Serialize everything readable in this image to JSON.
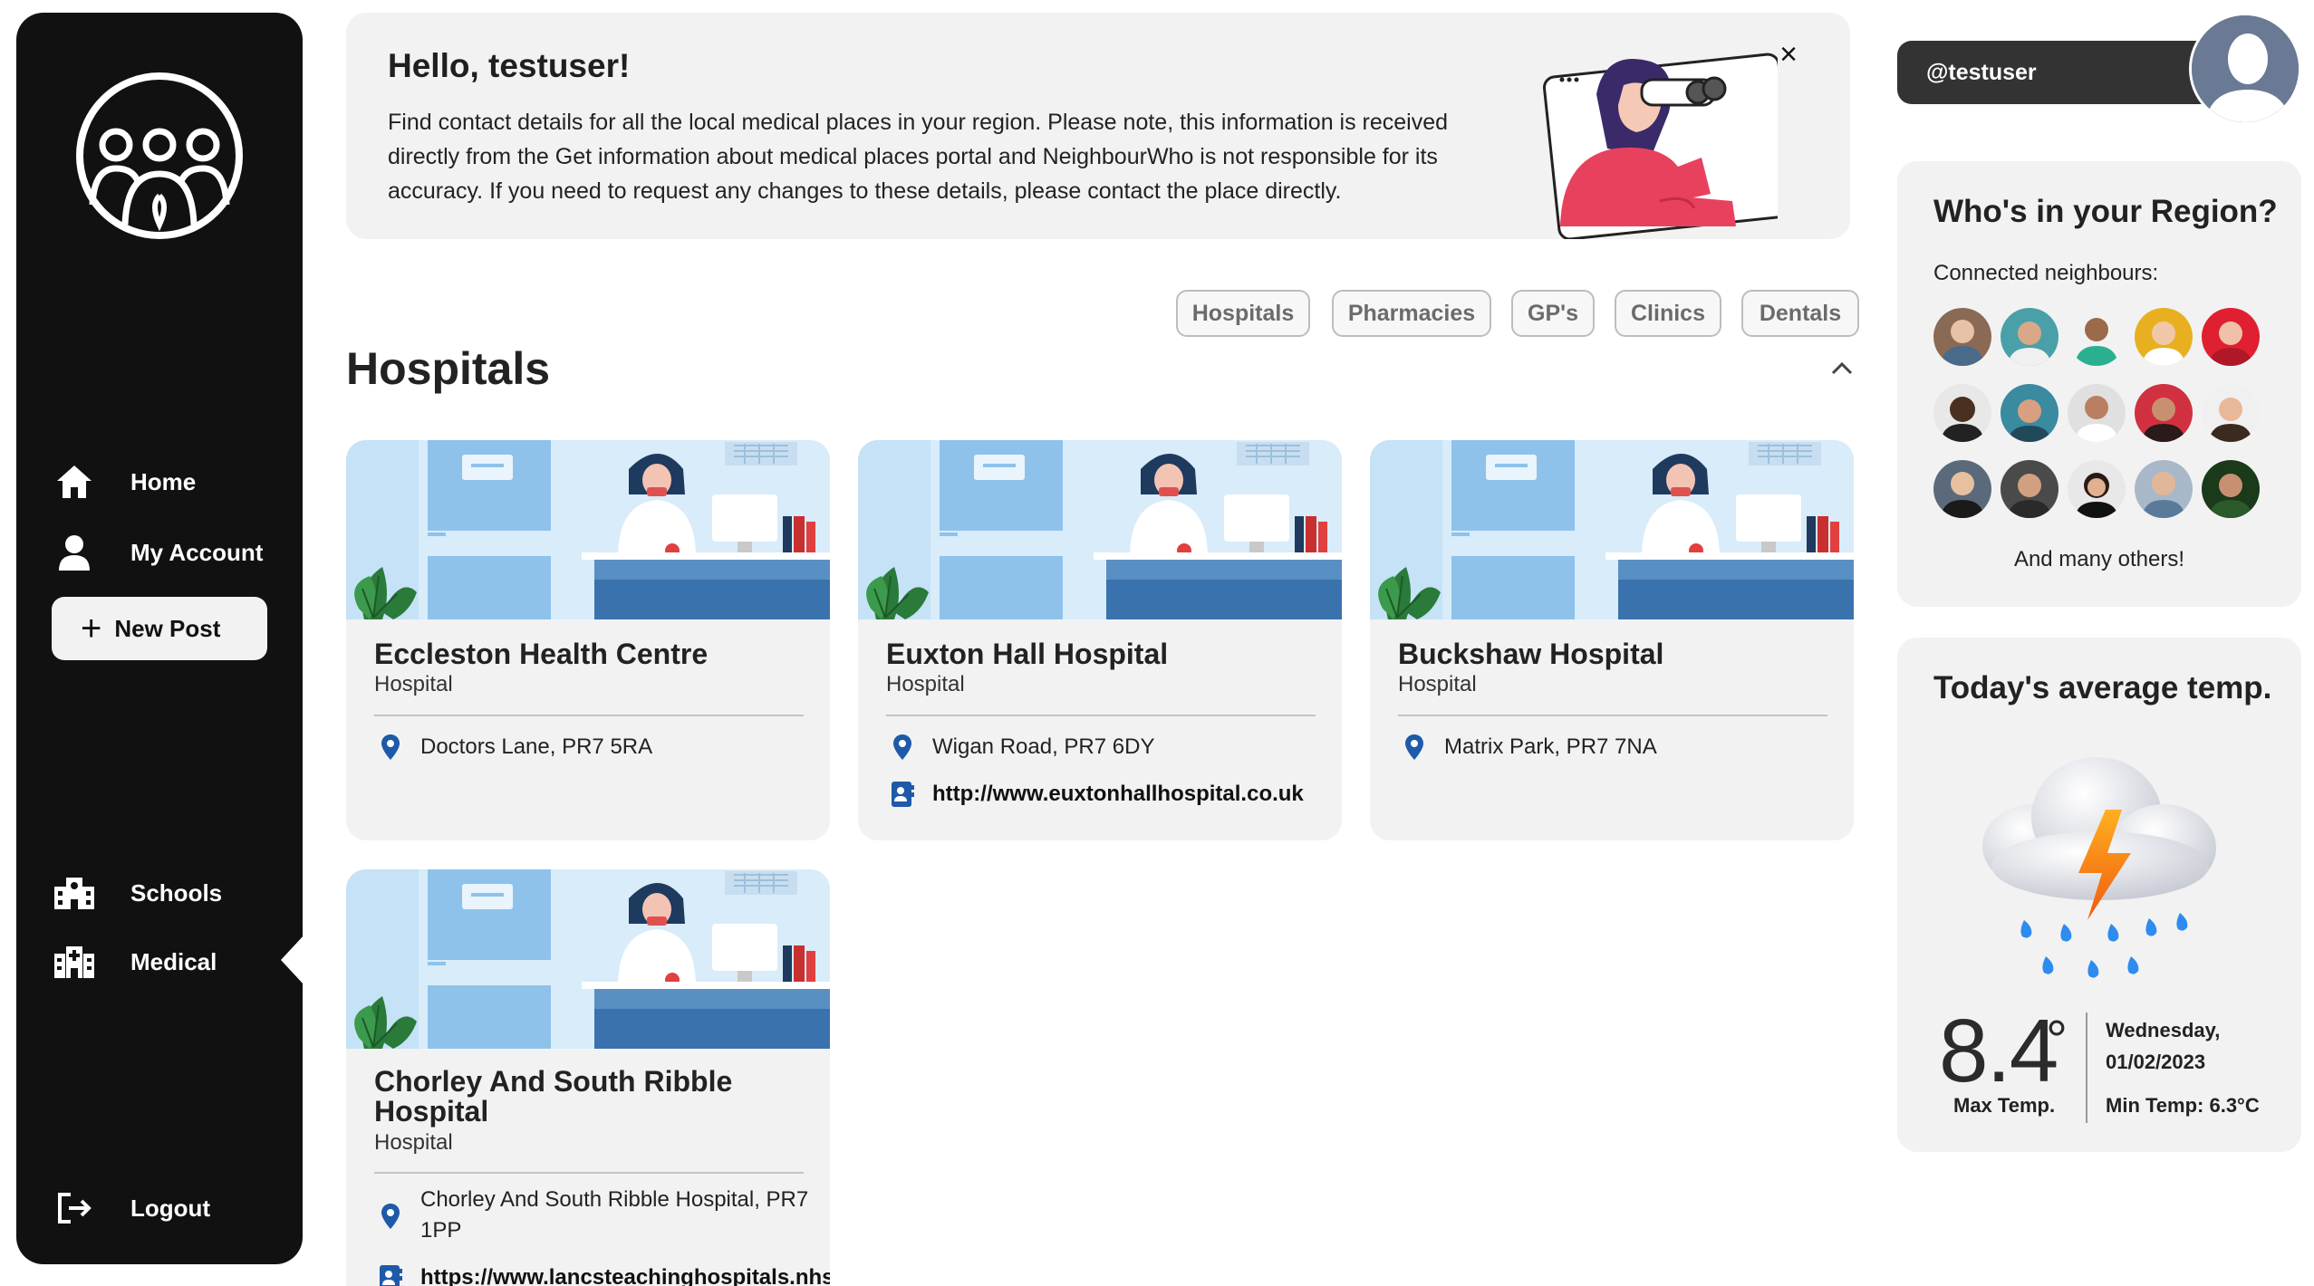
{
  "sidebar": {
    "nav": [
      {
        "label": "Home",
        "icon": "home-icon"
      },
      {
        "label": "My Account",
        "icon": "user-icon"
      },
      {
        "label": "Schools",
        "icon": "school-icon"
      },
      {
        "label": "Medical",
        "icon": "hospital-icon"
      },
      {
        "label": "Logout",
        "icon": "logout-icon"
      }
    ],
    "new_post_label": "New Post",
    "active_item": "Medical"
  },
  "banner": {
    "title": "Hello, testuser!",
    "text": "Find contact details for all the local medical places in your region. Please note, this information is received directly from the Get information about medical places portal and NeighbourWho is not responsible for its accuracy. If you need to request any changes to these details, please contact the place directly.",
    "close_label": "×"
  },
  "filters": [
    "Hospitals",
    "Pharmacies",
    "GP's",
    "Clinics",
    "Dentals"
  ],
  "section": {
    "title": "Hospitals"
  },
  "cards": [
    {
      "name": "Eccleston Health Centre",
      "type": "Hospital",
      "address": "Doctors Lane, PR7 5RA",
      "website": ""
    },
    {
      "name": "Euxton Hall Hospital",
      "type": "Hospital",
      "address": "Wigan Road, PR7 6DY",
      "website": "http://www.euxtonhallhospital.co.uk"
    },
    {
      "name": "Buckshaw Hospital",
      "type": "Hospital",
      "address": "Matrix Park, PR7 7NA",
      "website": ""
    },
    {
      "name": "Chorley And South Ribble Hospital",
      "type": "Hospital",
      "address": "Chorley And South Ribble Hospital, PR7 1PP",
      "website": "https://www.lancsteachinghospitals.nhs"
    }
  ],
  "user": {
    "handle": "@testuser"
  },
  "region": {
    "title": "Who's in your Region?",
    "subtitle": "Connected neighbours:",
    "footer": "And many others!"
  },
  "weather": {
    "title": "Today's average temp.",
    "temp": "8.4",
    "degree_symbol": "°",
    "max_label": "Max Temp.",
    "day": "Wednesday,",
    "date": "01/02/2023",
    "min_label": "Min Temp: 6.3°C",
    "condition_icon": "thunderstorm-rain-icon"
  },
  "colors": {
    "sidebar": "#111111",
    "card_bg": "#f2f2f2",
    "pin": "#1e5aa8",
    "pill": "#333333"
  }
}
